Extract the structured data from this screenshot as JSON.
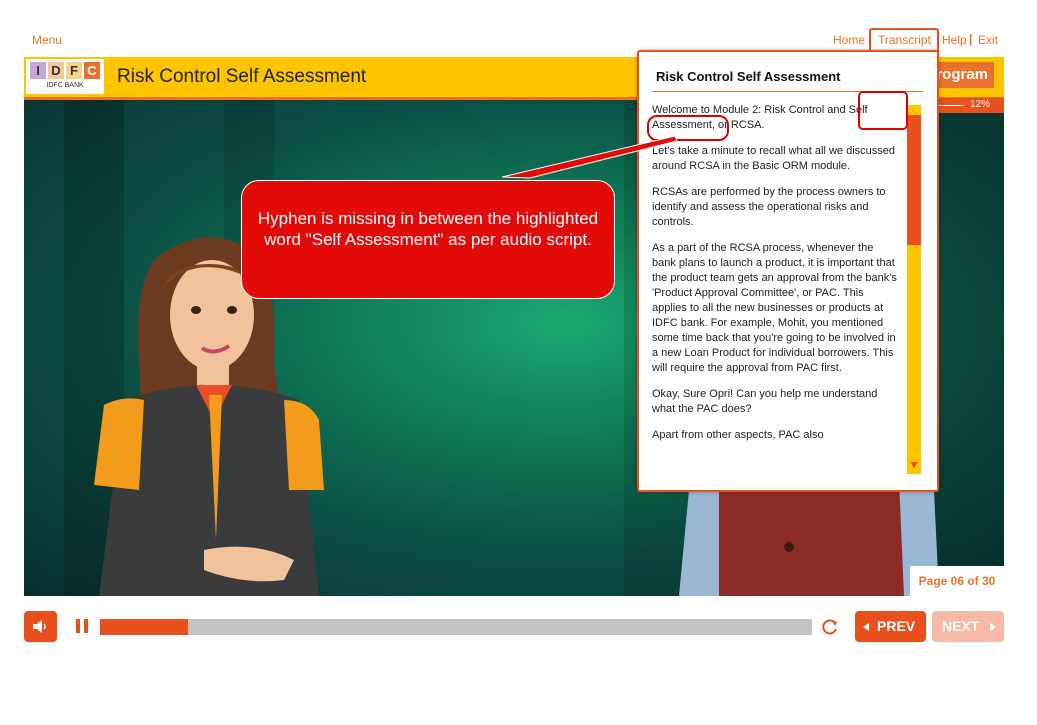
{
  "nav": {
    "menu": "Menu",
    "home": "Home",
    "transcript": "Transcript",
    "help": "Help",
    "separator": "|",
    "exit": "Exit"
  },
  "logo": {
    "letters": [
      "I",
      "D",
      "F",
      "C"
    ],
    "bank_name": "IDFC BANK"
  },
  "course": {
    "title": "Risk Control Self Assessment",
    "program_tab": "rogram",
    "progress_percent": 12,
    "progress_label": "12%"
  },
  "transcript": {
    "title": "Risk Control Self Assessment",
    "paragraphs": [
      "Welcome to Module 2: Risk Control and Self Assessment, or RCSA.",
      "Let's take a minute to recall what all we discussed around RCSA in the Basic ORM module.",
      "RCSAs are performed by the process owners to identify and assess the operational risks and controls.",
      "As a part of the RCSA process, whenever the bank plans to launch a product, it is important that the product team gets an approval from the bank's 'Product  Approval Committee', or PAC. This applies to all the new businesses or products at IDFC bank. For example, Mohit, you mentioned some time back that you're going to be involved in a new Loan Product for individual borrowers. This will require the approval from PAC first.",
      "Okay, Sure Opri! Can you help me understand what the PAC does?",
      "Apart from other aspects, PAC also"
    ]
  },
  "callout": {
    "text": "Hyphen is missing in between the highlighted word \"Self Assessment\" as per audio script."
  },
  "player": {
    "page_label": "Page 06 of 30",
    "seek_progress": 0.124,
    "prev_label": "PREV",
    "next_label": "NEXT"
  },
  "colors": {
    "accent": "#e8501e",
    "header_yellow": "#fdc400",
    "nav_orange": "#e8722c",
    "callout_red": "#e30a0a",
    "disabled": "#f6b9a3"
  },
  "icons": {
    "audio": "speaker-icon",
    "pause": "pause-icon",
    "replay": "replay-icon",
    "prev": "chevron-left-icon",
    "next": "chevron-right-icon",
    "scroll_up": "triangle-up-icon",
    "scroll_down": "triangle-down-icon"
  }
}
